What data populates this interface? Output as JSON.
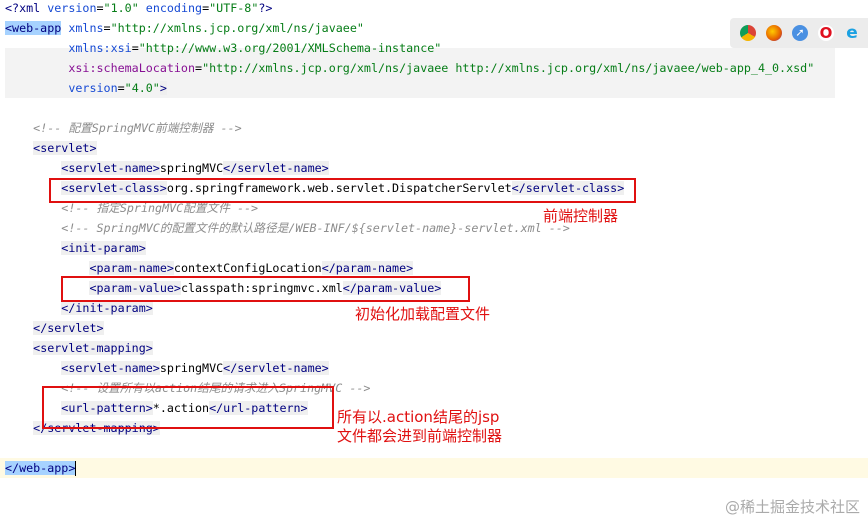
{
  "code_lines": [
    [
      {
        "c": "pi",
        "t": "<?xml "
      },
      {
        "c": "attr",
        "t": "version"
      },
      {
        "c": "text",
        "t": "="
      },
      {
        "c": "val",
        "t": "\"1.0\""
      },
      {
        "c": "text",
        "t": " "
      },
      {
        "c": "attr",
        "t": "encoding"
      },
      {
        "c": "text",
        "t": "="
      },
      {
        "c": "val",
        "t": "\"UTF-8\""
      },
      {
        "c": "pi",
        "t": "?>"
      }
    ],
    [
      {
        "c": "tagsel",
        "t": "<web-app"
      },
      {
        "c": "text",
        "t": " "
      },
      {
        "c": "attr",
        "t": "xmlns"
      },
      {
        "c": "text",
        "t": "="
      },
      {
        "c": "val",
        "t": "\"http://xmlns.jcp.org/xml/ns/javaee\""
      }
    ],
    [
      {
        "c": "text",
        "t": "         "
      },
      {
        "c": "attr",
        "t": "xmlns:xsi"
      },
      {
        "c": "text",
        "t": "="
      },
      {
        "c": "val",
        "t": "\"http://www.w3.org/2001/XMLSchema-instance\""
      }
    ],
    [
      {
        "c": "text",
        "t": "         "
      },
      {
        "c": "ns",
        "t": "xsi:schemaLocation"
      },
      {
        "c": "text",
        "t": "="
      },
      {
        "c": "val",
        "t": "\"http://xmlns.jcp.org/xml/ns/javaee http://xmlns.jcp.org/xml/ns/javaee/web-app_4_0.xsd\""
      }
    ],
    [
      {
        "c": "text",
        "t": "         "
      },
      {
        "c": "attr",
        "t": "version"
      },
      {
        "c": "text",
        "t": "="
      },
      {
        "c": "val",
        "t": "\"4.0\""
      },
      {
        "c": "tag",
        "t": ">"
      }
    ],
    [],
    [
      {
        "c": "text",
        "t": "    "
      },
      {
        "c": "comment",
        "t": "<!-- 配置SpringMVC前端控制器 -->"
      }
    ],
    [
      {
        "c": "text",
        "t": "    "
      },
      {
        "c": "tag",
        "t": "<servlet>"
      }
    ],
    [
      {
        "c": "text",
        "t": "        "
      },
      {
        "c": "tag",
        "t": "<servlet-name>"
      },
      {
        "c": "text",
        "t": "springMVC"
      },
      {
        "c": "tag",
        "t": "</servlet-name>"
      }
    ],
    [
      {
        "c": "text",
        "t": "        "
      },
      {
        "c": "tag",
        "t": "<servlet-class>"
      },
      {
        "c": "text",
        "t": "org.springframework.web.servlet.DispatcherServlet"
      },
      {
        "c": "tag",
        "t": "</servlet-class>"
      }
    ],
    [
      {
        "c": "text",
        "t": "        "
      },
      {
        "c": "comment",
        "t": "<!-- 指定SpringMVC配置文件 -->"
      }
    ],
    [
      {
        "c": "text",
        "t": "        "
      },
      {
        "c": "comment",
        "t": "<!-- SpringMVC的配置文件的默认路径是/WEB-INF/${servlet-name}-servlet.xml -->"
      }
    ],
    [
      {
        "c": "text",
        "t": "        "
      },
      {
        "c": "tag",
        "t": "<init-param>"
      }
    ],
    [
      {
        "c": "text",
        "t": "            "
      },
      {
        "c": "tag",
        "t": "<param-name>"
      },
      {
        "c": "text",
        "t": "contextConfigLocation"
      },
      {
        "c": "tag",
        "t": "</param-name>"
      }
    ],
    [
      {
        "c": "text",
        "t": "            "
      },
      {
        "c": "tag",
        "t": "<param-value>"
      },
      {
        "c": "text",
        "t": "classpath:springmvc.xml"
      },
      {
        "c": "tag",
        "t": "</param-value>"
      }
    ],
    [
      {
        "c": "text",
        "t": "        "
      },
      {
        "c": "tag",
        "t": "</init-param>"
      }
    ],
    [
      {
        "c": "text",
        "t": "    "
      },
      {
        "c": "tag",
        "t": "</servlet>"
      }
    ],
    [
      {
        "c": "text",
        "t": "    "
      },
      {
        "c": "tag",
        "t": "<servlet-mapping>"
      }
    ],
    [
      {
        "c": "text",
        "t": "        "
      },
      {
        "c": "tag",
        "t": "<servlet-name>"
      },
      {
        "c": "text",
        "t": "springMVC"
      },
      {
        "c": "tag",
        "t": "</servlet-name>"
      }
    ],
    [
      {
        "c": "text",
        "t": "        "
      },
      {
        "c": "comment",
        "t": "<!-- 设置所有以action结尾的请求进入SpringMVC -->"
      }
    ],
    [
      {
        "c": "text",
        "t": "        "
      },
      {
        "c": "tag",
        "t": "<url-pattern>"
      },
      {
        "c": "text",
        "t": "*.action"
      },
      {
        "c": "tag",
        "t": "</url-pattern>"
      }
    ],
    [
      {
        "c": "text",
        "t": "    "
      },
      {
        "c": "tag",
        "t": "</servlet-mapping>"
      }
    ],
    [],
    [
      {
        "c": "tagsel",
        "t": "</web-app>"
      }
    ]
  ],
  "annotations": {
    "front_controller": "前端控制器",
    "init_config": "初始化加载配置文件",
    "action_line1": "所有以.action结尾的jsp",
    "action_line2": "文件都会进到前端控制器"
  },
  "browser_icons": [
    "chrome-icon",
    "firefox-icon",
    "safari-icon",
    "opera-icon",
    "ie-icon"
  ],
  "watermark": "@稀土掘金技术社区"
}
